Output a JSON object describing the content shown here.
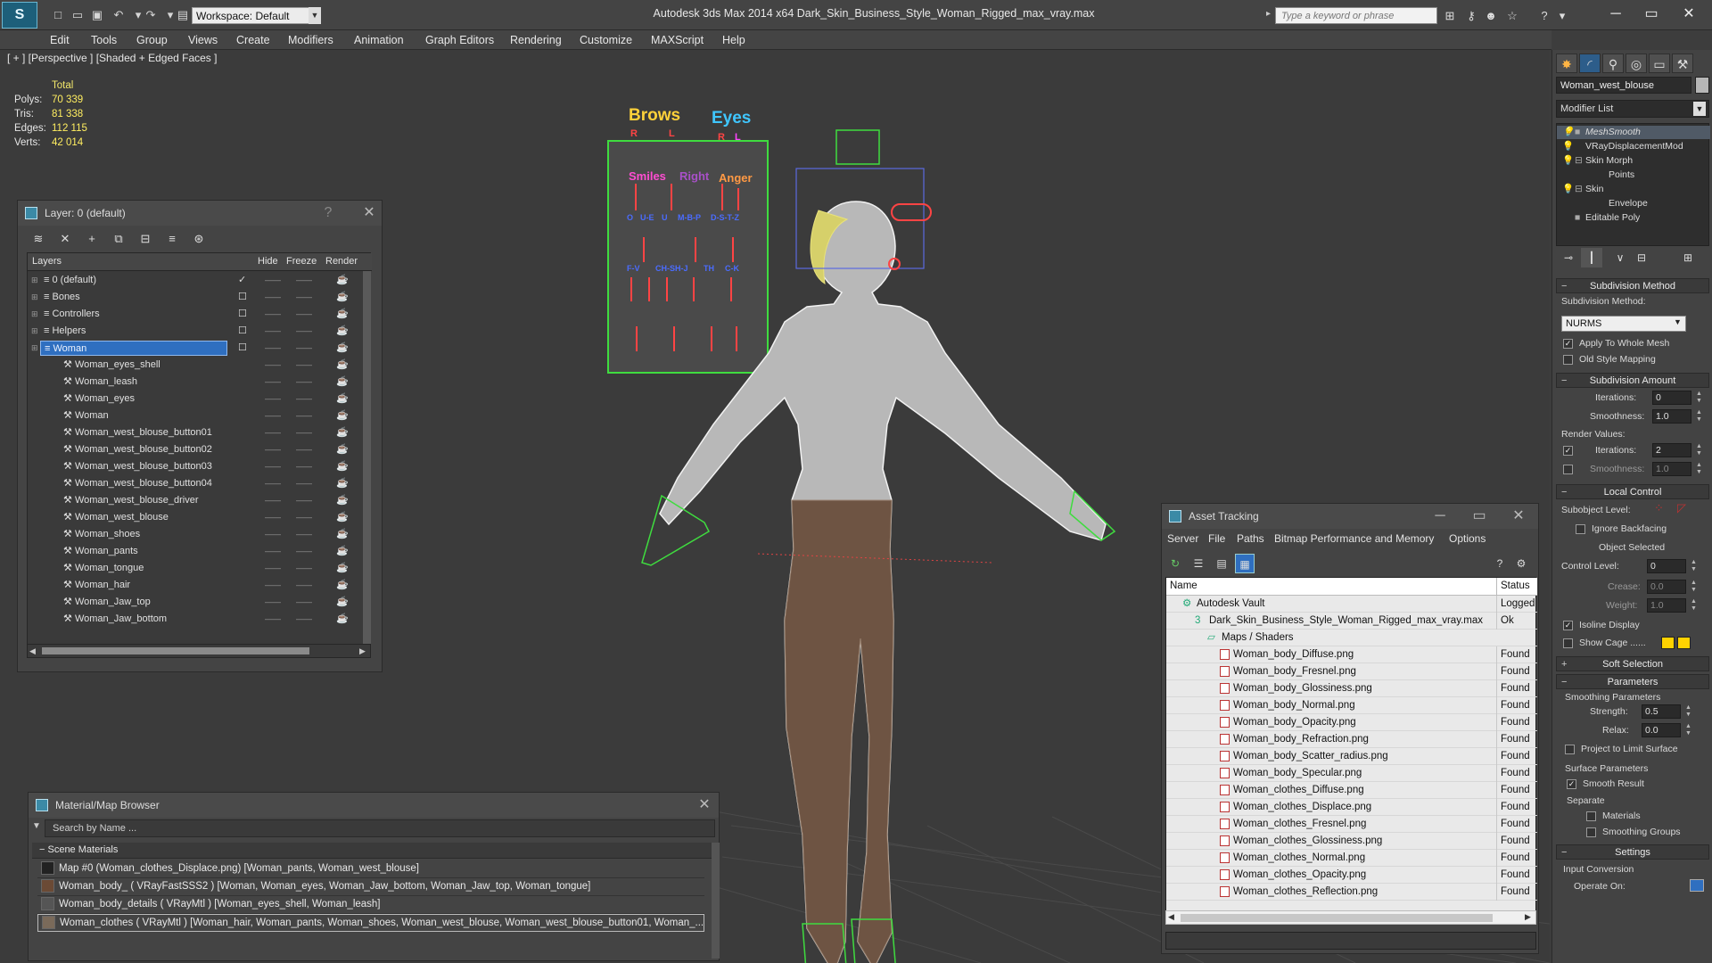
{
  "app": {
    "title": "Autodesk 3ds Max  2014 x64      Dark_Skin_Business_Style_Woman_Rigged_max_vray.max",
    "workspace": "Workspace: Default",
    "search_placeholder": "Type a keyword or phrase"
  },
  "menu": [
    "Edit",
    "Tools",
    "Group",
    "Views",
    "Create",
    "Modifiers",
    "Animation",
    "Graph Editors",
    "Rendering",
    "Customize",
    "MAXScript",
    "Help"
  ],
  "viewport": {
    "label": "[ + ] [Perspective ] [Shaded + Edged Faces ]",
    "stats": {
      "header": "Total",
      "rows": [
        {
          "k": "Polys:",
          "v": "70 339"
        },
        {
          "k": "Tris:",
          "v": "81 338"
        },
        {
          "k": "Edges:",
          "v": "112 115"
        },
        {
          "k": "Verts:",
          "v": "42 014"
        }
      ]
    },
    "board": {
      "brows": "Brows",
      "eyes": "Eyes",
      "r1": "R",
      "l1": "L",
      "r2": "R",
      "l2": "L",
      "smiles": "Smiles",
      "right": "Right",
      "anger": "Anger",
      "row3": [
        "O",
        "U-E",
        "U",
        "M-B-P",
        "D-S-T-Z"
      ],
      "row4": [
        "F-V",
        "CH-SH-J",
        "TH",
        "C-K"
      ]
    }
  },
  "layer_window": {
    "title": "Layer: 0 (default)",
    "help": "?",
    "columns": {
      "layers": "Layers",
      "hide": "Hide",
      "freeze": "Freeze",
      "render": "Render"
    },
    "rows": [
      {
        "name": "0 (default)",
        "level": 0,
        "check": "✓"
      },
      {
        "name": "Bones",
        "level": 0,
        "check": "☐"
      },
      {
        "name": "Controllers",
        "level": 0,
        "check": "☐"
      },
      {
        "name": "Helpers",
        "level": 0,
        "check": "☐"
      },
      {
        "name": "Woman",
        "level": 0,
        "check": "☐",
        "selected": true
      },
      {
        "name": "Woman_eyes_shell",
        "level": 1
      },
      {
        "name": "Woman_leash",
        "level": 1
      },
      {
        "name": "Woman_eyes",
        "level": 1
      },
      {
        "name": "Woman",
        "level": 1
      },
      {
        "name": "Woman_west_blouse_button01",
        "level": 1
      },
      {
        "name": "Woman_west_blouse_button02",
        "level": 1
      },
      {
        "name": "Woman_west_blouse_button03",
        "level": 1
      },
      {
        "name": "Woman_west_blouse_button04",
        "level": 1
      },
      {
        "name": "Woman_west_blouse_driver",
        "level": 1
      },
      {
        "name": "Woman_west_blouse",
        "level": 1
      },
      {
        "name": "Woman_shoes",
        "level": 1
      },
      {
        "name": "Woman_pants",
        "level": 1
      },
      {
        "name": "Woman_tongue",
        "level": 1
      },
      {
        "name": "Woman_hair",
        "level": 1
      },
      {
        "name": "Woman_Jaw_top",
        "level": 1
      },
      {
        "name": "Woman_Jaw_bottom",
        "level": 1
      }
    ]
  },
  "material_browser": {
    "title": "Material/Map Browser",
    "search_placeholder": "Search by Name ...",
    "section": "Scene Materials",
    "rows": [
      {
        "text": "Map #0 (Woman_clothes_Displace.png) [Woman_pants, Woman_west_blouse]",
        "swatch": "#222222"
      },
      {
        "text": "Woman_body_  ( VRayFastSSS2 ) [Woman, Woman_eyes, Woman_Jaw_bottom, Woman_Jaw_top, Woman_tongue]",
        "swatch": "#6b4a35"
      },
      {
        "text": "Woman_body_details  ( VRayMtl ) [Woman_eyes_shell, Woman_leash]",
        "swatch": "#555555"
      },
      {
        "text": "Woman_clothes  ( VRayMtl ) [Woman_hair, Woman_pants, Woman_shoes, Woman_west_blouse, Woman_west_blouse_button01, Woman_...",
        "swatch": "#7a6a5a",
        "selected": true
      }
    ]
  },
  "asset_tracking": {
    "title": "Asset Tracking",
    "menu": [
      "Server",
      "File",
      "Paths",
      "Bitmap Performance and Memory",
      "Options"
    ],
    "columns": {
      "name": "Name",
      "status": "Status"
    },
    "rows": [
      {
        "name": "Autodesk Vault",
        "status": "Logged Out",
        "indent": 1,
        "icon": "vault"
      },
      {
        "name": "Dark_Skin_Business_Style_Woman_Rigged_max_vray.max",
        "status": "Ok",
        "indent": 2,
        "icon": "max"
      },
      {
        "name": "Maps / Shaders",
        "status": "",
        "indent": 3,
        "icon": "folder"
      },
      {
        "name": "Woman_body_Diffuse.png",
        "status": "Found",
        "indent": 4,
        "icon": "png"
      },
      {
        "name": "Woman_body_Fresnel.png",
        "status": "Found",
        "indent": 4,
        "icon": "png"
      },
      {
        "name": "Woman_body_Glossiness.png",
        "status": "Found",
        "indent": 4,
        "icon": "png"
      },
      {
        "name": "Woman_body_Normal.png",
        "status": "Found",
        "indent": 4,
        "icon": "png"
      },
      {
        "name": "Woman_body_Opacity.png",
        "status": "Found",
        "indent": 4,
        "icon": "png"
      },
      {
        "name": "Woman_body_Refraction.png",
        "status": "Found",
        "indent": 4,
        "icon": "png"
      },
      {
        "name": "Woman_body_Scatter_radius.png",
        "status": "Found",
        "indent": 4,
        "icon": "png"
      },
      {
        "name": "Woman_body_Specular.png",
        "status": "Found",
        "indent": 4,
        "icon": "png"
      },
      {
        "name": "Woman_clothes_Diffuse.png",
        "status": "Found",
        "indent": 4,
        "icon": "png"
      },
      {
        "name": "Woman_clothes_Displace.png",
        "status": "Found",
        "indent": 4,
        "icon": "png"
      },
      {
        "name": "Woman_clothes_Fresnel.png",
        "status": "Found",
        "indent": 4,
        "icon": "png"
      },
      {
        "name": "Woman_clothes_Glossiness.png",
        "status": "Found",
        "indent": 4,
        "icon": "png"
      },
      {
        "name": "Woman_clothes_Normal.png",
        "status": "Found",
        "indent": 4,
        "icon": "png"
      },
      {
        "name": "Woman_clothes_Opacity.png",
        "status": "Found",
        "indent": 4,
        "icon": "png"
      },
      {
        "name": "Woman_clothes_Reflection.png",
        "status": "Found",
        "indent": 4,
        "icon": "png"
      }
    ]
  },
  "command_panel": {
    "object_name": "Woman_west_blouse",
    "modifier_list": "Modifier List",
    "stack": [
      {
        "name": "MeshSmooth",
        "eye": "💡",
        "plus": "■",
        "indent": 0
      },
      {
        "name": "VRayDisplacementMod",
        "eye": "💡",
        "plus": "",
        "indent": 0
      },
      {
        "name": "Skin Morph",
        "eye": "💡",
        "plus": "⊟",
        "indent": 0
      },
      {
        "name": "Points",
        "eye": "",
        "plus": "",
        "indent": 1
      },
      {
        "name": "Skin",
        "eye": "💡",
        "plus": "⊟",
        "indent": 0
      },
      {
        "name": "Envelope",
        "eye": "",
        "plus": "",
        "indent": 1
      },
      {
        "name": "Editable Poly",
        "eye": "",
        "plus": "■",
        "indent": 0
      }
    ],
    "subdivision_method": {
      "header": "Subdivision Method",
      "label": "Subdivision Method:",
      "value": "NURMS",
      "apply_whole": "Apply To Whole Mesh",
      "old_style": "Old Style Mapping"
    },
    "subdivision_amount": {
      "header": "Subdivision Amount",
      "iterations_label": "Iterations:",
      "iterations": "0",
      "smoothness_label": "Smoothness:",
      "smoothness": "1.0",
      "render_values": "Render Values:",
      "r_iterations_label": "Iterations:",
      "r_iterations": "2",
      "r_smoothness_label": "Smoothness:",
      "r_smoothness": "1.0"
    },
    "local_control": {
      "header": "Local Control",
      "subobject_label": "Subobject Level:",
      "ignore_backfacing": "Ignore Backfacing",
      "object_selected": "Object Selected",
      "control_level_label": "Control Level:",
      "control_level": "0",
      "crease_label": "Crease:",
      "crease": "0.0",
      "weight_label": "Weight:",
      "weight": "1.0",
      "isoline": "Isoline Display",
      "show_cage": "Show Cage ......"
    },
    "soft_selection": {
      "header": "Soft Selection"
    },
    "parameters": {
      "header": "Parameters",
      "smoothing_params": "Smoothing Parameters",
      "strength_label": "Strength:",
      "strength": "0.5",
      "relax_label": "Relax:",
      "relax": "0.0",
      "project": "Project to Limit Surface",
      "surface_params": "Surface Parameters",
      "smooth_result": "Smooth Result",
      "separate": "Separate",
      "materials": "Materials",
      "smoothing_groups": "Smoothing Groups"
    },
    "settings": {
      "header": "Settings",
      "input_conversion": "Input Conversion",
      "operate_on": "Operate On:"
    }
  },
  "colors": {
    "accent": "#2f6fc0",
    "stats": "#ffee60",
    "cage1": "#ffd200",
    "cage2": "#ffd200"
  }
}
